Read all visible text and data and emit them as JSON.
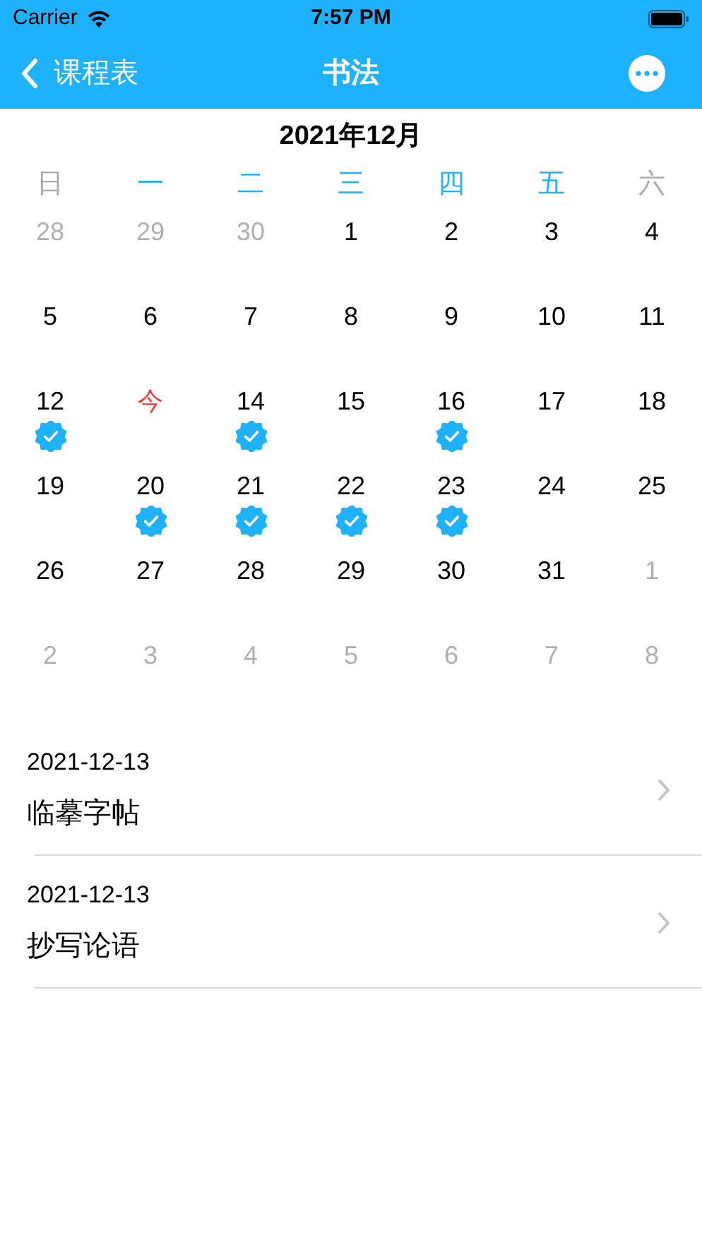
{
  "status_bar": {
    "carrier": "Carrier",
    "time": "7:57 PM"
  },
  "nav": {
    "back_label": "课程表",
    "title": "书法"
  },
  "calendar": {
    "month_title": "2021年12月",
    "weekdays": [
      {
        "label": "日",
        "color": "#aaaaaa"
      },
      {
        "label": "一",
        "color": "#1eb1fd"
      },
      {
        "label": "二",
        "color": "#1eb1fd"
      },
      {
        "label": "三",
        "color": "#1eb1fd"
      },
      {
        "label": "四",
        "color": "#1eb1fd"
      },
      {
        "label": "五",
        "color": "#1eb1fd"
      },
      {
        "label": "六",
        "color": "#aaaaaa"
      }
    ],
    "days": [
      {
        "text": "28",
        "kind": "other",
        "checked": false
      },
      {
        "text": "29",
        "kind": "other",
        "checked": false
      },
      {
        "text": "30",
        "kind": "other",
        "checked": false
      },
      {
        "text": "1",
        "kind": "current",
        "checked": false
      },
      {
        "text": "2",
        "kind": "current",
        "checked": false
      },
      {
        "text": "3",
        "kind": "current",
        "checked": false
      },
      {
        "text": "4",
        "kind": "current",
        "checked": false
      },
      {
        "text": "5",
        "kind": "current",
        "checked": false
      },
      {
        "text": "6",
        "kind": "current",
        "checked": false
      },
      {
        "text": "7",
        "kind": "current",
        "checked": false
      },
      {
        "text": "8",
        "kind": "current",
        "checked": false
      },
      {
        "text": "9",
        "kind": "current",
        "checked": false
      },
      {
        "text": "10",
        "kind": "current",
        "checked": false
      },
      {
        "text": "11",
        "kind": "current",
        "checked": false
      },
      {
        "text": "12",
        "kind": "current",
        "checked": true
      },
      {
        "text": "今",
        "kind": "today",
        "checked": false
      },
      {
        "text": "14",
        "kind": "current",
        "checked": true
      },
      {
        "text": "15",
        "kind": "current",
        "checked": false
      },
      {
        "text": "16",
        "kind": "current",
        "checked": true
      },
      {
        "text": "17",
        "kind": "current",
        "checked": false
      },
      {
        "text": "18",
        "kind": "current",
        "checked": false
      },
      {
        "text": "19",
        "kind": "current",
        "checked": false
      },
      {
        "text": "20",
        "kind": "current",
        "checked": true
      },
      {
        "text": "21",
        "kind": "current",
        "checked": true
      },
      {
        "text": "22",
        "kind": "current",
        "checked": true
      },
      {
        "text": "23",
        "kind": "current",
        "checked": true
      },
      {
        "text": "24",
        "kind": "current",
        "checked": false
      },
      {
        "text": "25",
        "kind": "current",
        "checked": false
      },
      {
        "text": "26",
        "kind": "current",
        "checked": false
      },
      {
        "text": "27",
        "kind": "current",
        "checked": false
      },
      {
        "text": "28",
        "kind": "current",
        "checked": false
      },
      {
        "text": "29",
        "kind": "current",
        "checked": false
      },
      {
        "text": "30",
        "kind": "current",
        "checked": false
      },
      {
        "text": "31",
        "kind": "current",
        "checked": false
      },
      {
        "text": "1",
        "kind": "other",
        "checked": false
      },
      {
        "text": "2",
        "kind": "other",
        "checked": false
      },
      {
        "text": "3",
        "kind": "other",
        "checked": false
      },
      {
        "text": "4",
        "kind": "other",
        "checked": false
      },
      {
        "text": "5",
        "kind": "other",
        "checked": false
      },
      {
        "text": "6",
        "kind": "other",
        "checked": false
      },
      {
        "text": "7",
        "kind": "other",
        "checked": false
      },
      {
        "text": "8",
        "kind": "other",
        "checked": false
      }
    ]
  },
  "lessons": [
    {
      "date": "2021-12-13",
      "title": "临摹字帖"
    },
    {
      "date": "2021-12-13",
      "title": "抄写论语"
    }
  ]
}
